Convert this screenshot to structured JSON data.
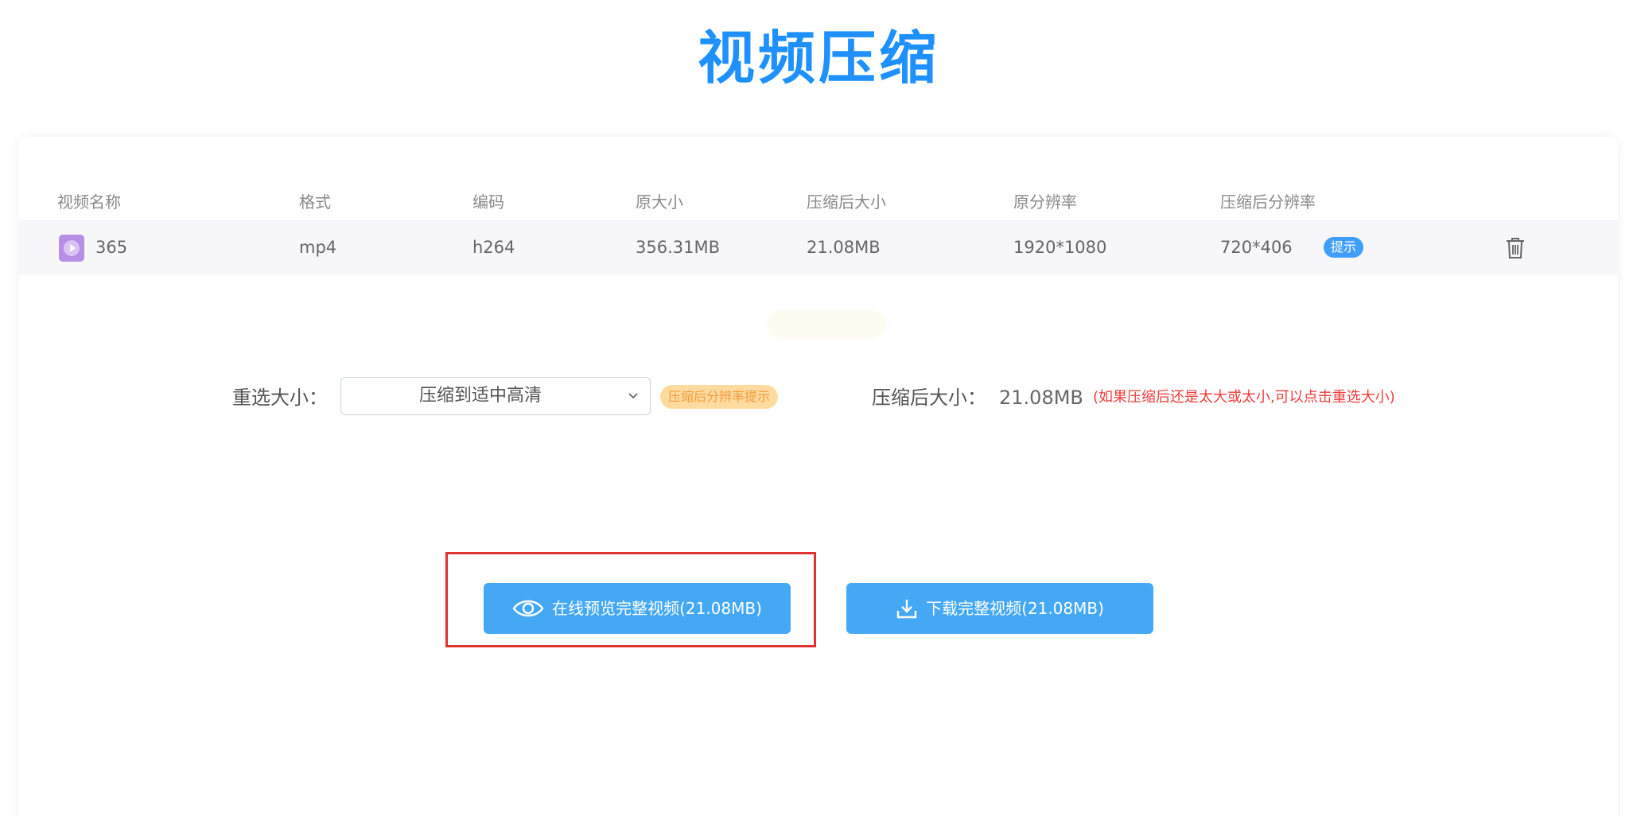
{
  "page": {
    "title": "视频压缩"
  },
  "table": {
    "headers": {
      "name": "视频名称",
      "format": "格式",
      "codec": "编码",
      "original_size": "原大小",
      "compressed_size": "压缩后大小",
      "original_resolution": "原分辨率",
      "compressed_resolution": "压缩后分辨率"
    },
    "row": {
      "name": "365",
      "format": "mp4",
      "codec": "h264",
      "original_size": "356.31MB",
      "compressed_size": "21.08MB",
      "original_resolution": "1920*1080",
      "compressed_resolution": "720*406",
      "hint_badge": "提示",
      "file_icon": "video-file-icon",
      "delete_icon": "trash-icon"
    }
  },
  "resize": {
    "label": "重选大小：",
    "selected": "压缩到适中高清",
    "resolution_hint": "压缩后分辨率提示",
    "compressed_label": "压缩后大小：",
    "compressed_value": "21.08MB",
    "note": "(如果压缩后还是太大或太小,可以点击重选大小)"
  },
  "actions": {
    "preview_label": "在线预览完整视频(21.08MB)",
    "download_label": "下载完整视频(21.08MB)",
    "preview_icon": "eye-icon",
    "download_icon": "download-icon"
  },
  "colors": {
    "title": "#1e90ff",
    "button": "#45a8f5",
    "hint_badge": "#409eff",
    "resolution_badge_bg": "#ffdba0",
    "resolution_badge_text": "#f39c3a",
    "note": "#f03c3c",
    "highlight": "#e0322f"
  }
}
